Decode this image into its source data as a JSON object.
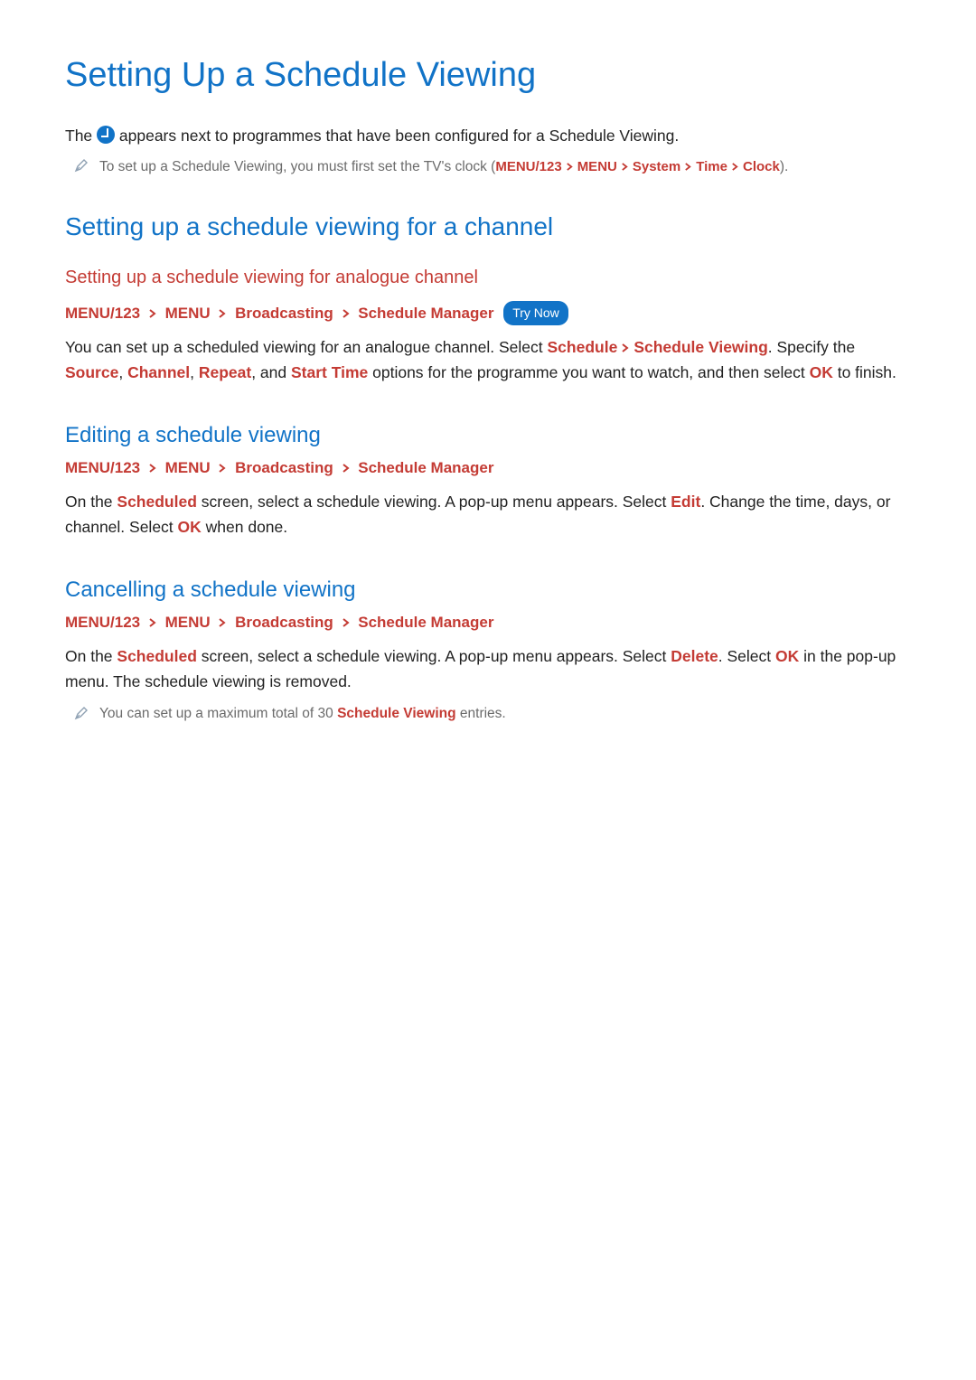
{
  "title": "Setting Up a Schedule Viewing",
  "intro": {
    "pre": "The ",
    "post": " appears next to programmes that have been configured for a Schedule Viewing."
  },
  "note_clock": {
    "text": "To set up a Schedule Viewing, you must first set the TV's clock (",
    "path": [
      "MENU/123",
      "MENU",
      "System",
      "Time",
      "Clock"
    ],
    "close": ")."
  },
  "section1": {
    "heading": "Setting up a schedule viewing for a channel",
    "sub_heading": "Setting up a schedule viewing for analogue channel",
    "path": [
      "MENU/123",
      "MENU",
      "Broadcasting",
      "Schedule Manager"
    ],
    "try_now": "Try Now",
    "body_pre": "You can set up a scheduled viewing for an analogue channel. Select ",
    "kw1": "Schedule",
    "kw2": "Schedule Viewing",
    "body_mid1": ". Specify the ",
    "kw3": "Source",
    "kw4": "Channel",
    "kw5": "Repeat",
    "kw6": "Start Time",
    "body_mid2": " options for the programme you want to watch, and then select ",
    "kw7": "OK",
    "body_post": " to finish."
  },
  "section2": {
    "heading": "Editing a schedule viewing",
    "path": [
      "MENU/123",
      "MENU",
      "Broadcasting",
      "Schedule Manager"
    ],
    "body_pre": "On the ",
    "kw1": "Scheduled",
    "body_mid1": " screen, select a schedule viewing. A pop-up menu appears. Select ",
    "kw2": "Edit",
    "body_mid2": ". Change the time, days, or channel. Select ",
    "kw3": "OK",
    "body_post": " when done."
  },
  "section3": {
    "heading": "Cancelling a schedule viewing",
    "path": [
      "MENU/123",
      "MENU",
      "Broadcasting",
      "Schedule Manager"
    ],
    "body_pre": "On the ",
    "kw1": "Scheduled",
    "body_mid1": " screen, select a schedule viewing. A pop-up menu appears. Select ",
    "kw2": "Delete",
    "body_mid2": ". Select ",
    "kw3": "OK",
    "body_post": " in the pop-up menu. The schedule viewing is removed.",
    "note_pre": "You can set up a maximum total of 30 ",
    "note_kw": "Schedule Viewing",
    "note_post": " entries."
  }
}
